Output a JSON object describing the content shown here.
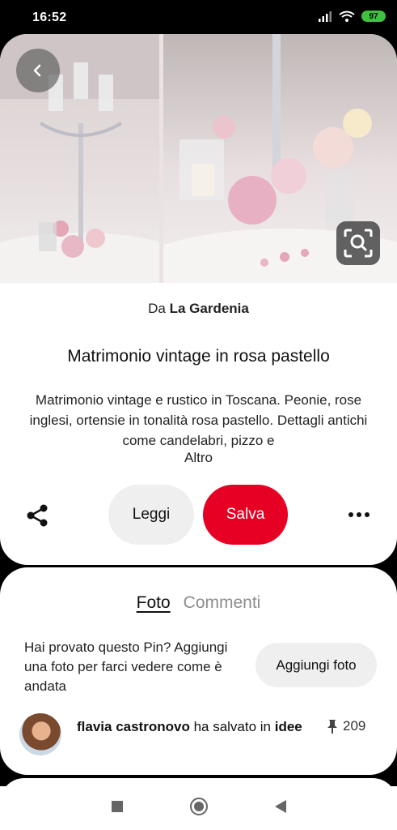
{
  "status_bar": {
    "time": "16:52",
    "battery_level": "97",
    "icons": [
      "signal-icon",
      "wifi-icon",
      "battery-icon"
    ]
  },
  "pin": {
    "source_prefix": "Da",
    "source_name": "La Gardenia",
    "title": "Matrimonio vintage in rosa pastello",
    "description": "Matrimonio vintage e rustico in Toscana. Peonie, rose inglesi, ortensie in tonalità rosa pastello. Dettagli antichi come candelabri, pizzo e",
    "more_link": "Altro",
    "read_label": "Leggi",
    "save_label": "Salva",
    "accent_color": "#e60023"
  },
  "comments": {
    "tabs": [
      {
        "label": "Foto",
        "active": true
      },
      {
        "label": "Commenti",
        "active": false
      }
    ],
    "tried_text": "Hai provato questo Pin? Aggiungi una foto per farci vedere come è andata",
    "add_photo_label": "Aggiungi foto",
    "activity": {
      "user": "flavia castronovo",
      "action": "ha salvato in",
      "board": "idee",
      "save_count": "209"
    }
  }
}
